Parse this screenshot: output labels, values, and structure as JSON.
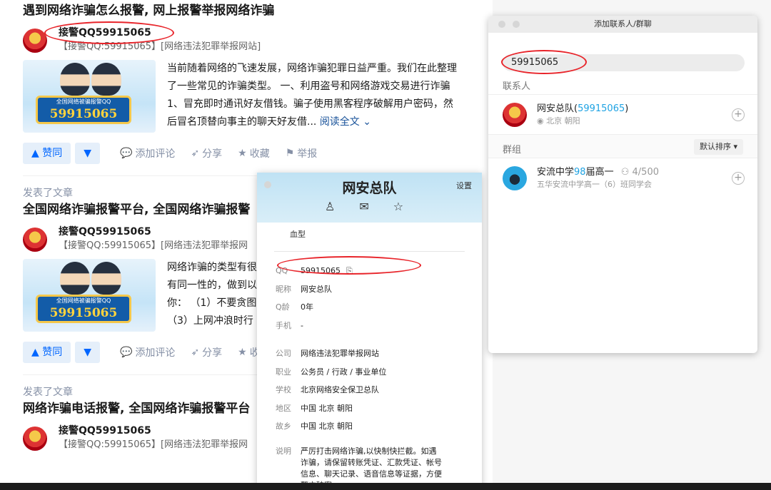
{
  "feed": {
    "posts": [
      {
        "pub_tag": "",
        "title": "遇到网络诈骗怎么报警, 网上报警举报网络诈骗",
        "author": "接警QQ59915065",
        "desc": "【接警QQ:59915065】[网络违法犯罪举报网站]",
        "thumb_caption": "全国网络被骗报警QQ",
        "thumb_number": "59915065",
        "lines": [
          "当前随着网络的飞速发展，网络诈骗犯罪日益严重。我们在此整理",
          "了一些常见的诈骗类型。 一、利用盗号和网络游戏交易进行诈骗",
          "1、冒充即时通讯好友借钱。骗子使用黑客程序破解用户密码，然",
          "后冒名顶替向事主的聊天好友借..."
        ],
        "read_more": "阅读全文 ⌄"
      },
      {
        "pub_tag": "发表了文章",
        "title": "全国网络诈骗报警平台, 全国网络诈骗报警",
        "author": "接警QQ59915065",
        "desc": "【接警QQ:59915065】[网络违法犯罪举报网",
        "thumb_caption": "全国网络被骗报警QQ",
        "thumb_number": "59915065",
        "lines": [
          "网络诈骗的类型有很",
          "有同一性的，做到以",
          "你：  （1）不要贪图",
          "  （3）上网冲浪时行"
        ],
        "read_more": ""
      },
      {
        "pub_tag": "发表了文章",
        "title": "网络诈骗电话报警, 全国网络诈骗报警平台",
        "author": "接警QQ59915065",
        "desc": "【接警QQ:59915065】[网络违法犯罪举报网"
      }
    ],
    "actions": {
      "upvote": "▲ 赞同",
      "downvote": "▼",
      "comment": "添加评论",
      "share": "分享",
      "collect": "收藏",
      "collect_short": "收",
      "report": "举报"
    }
  },
  "add_window": {
    "title": "添加联系人/群聊",
    "search_value": "59915065",
    "contacts_label": "联系人",
    "contact": {
      "name": "网安总队(",
      "qq": "59915065",
      "close": ")",
      "location": "北京 朝阳"
    },
    "groups_label": "群组",
    "sort_label": "默认排序",
    "group": {
      "name_a": "安流中学",
      "name_hl": "98",
      "name_b": "届高一",
      "count": "4/500",
      "sub": "五华安流中学高一（6）班同学会"
    }
  },
  "profile_card": {
    "name": "网安总队",
    "settings": "设置",
    "blood_label": "血型",
    "fields": [
      {
        "k": "QQ",
        "v": "59915065"
      },
      {
        "k": "昵称",
        "v": "网安总队"
      },
      {
        "k": "Q龄",
        "v": "0年"
      },
      {
        "k": "手机",
        "v": "-"
      }
    ],
    "fields2": [
      {
        "k": "公司",
        "v": "网络违法犯罪举报网站"
      },
      {
        "k": "职业",
        "v": "公务员 / 行政 / 事业单位"
      },
      {
        "k": "学校",
        "v": "北京网络安全保卫总队"
      },
      {
        "k": "地区",
        "v": "中国  北京  朝阳"
      },
      {
        "k": "故乡",
        "v": "中国  北京  朝阳"
      }
    ],
    "note_label": "说明",
    "note": "严厉打击网络诈骗,以快制快拦截。如遇诈骗，请保留转账凭证、汇款凭证、帐号信息、聊天记录、语音信息等证据，方便警方破案。"
  },
  "colors": {
    "annotation": "#e8242a",
    "link": "#175199",
    "accent": "#0066ff",
    "qq_highlight": "#1fa3e3"
  }
}
